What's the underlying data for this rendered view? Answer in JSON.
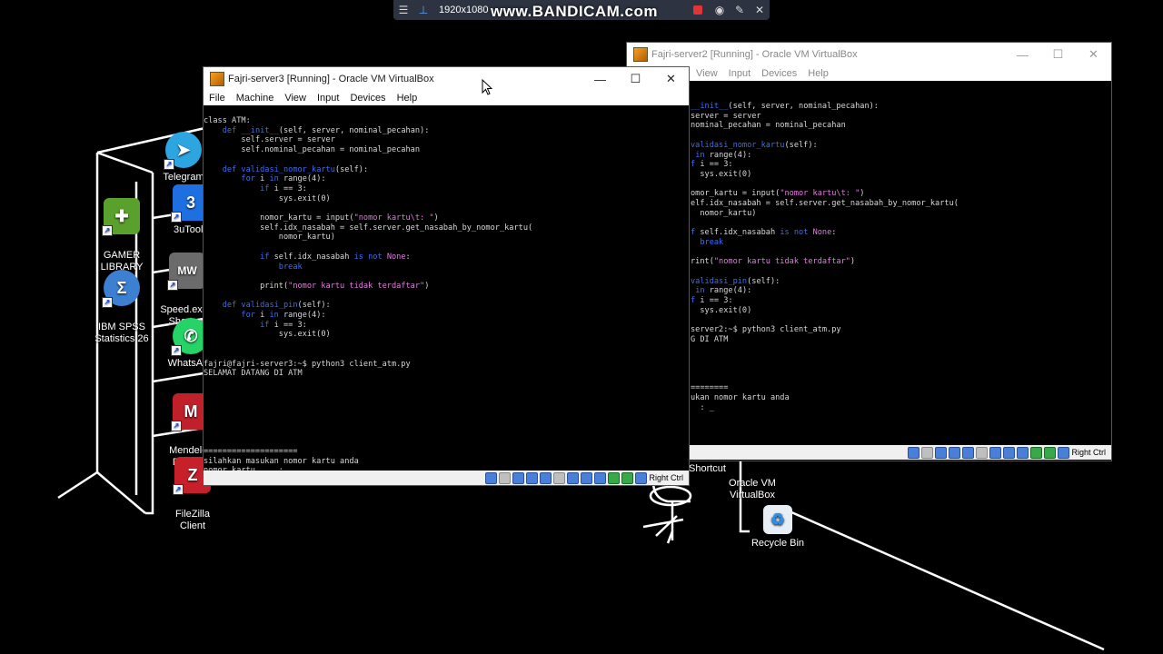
{
  "bandicam": {
    "resolution": "1920x1080",
    "watermark": "www.BANDICAM.com"
  },
  "desktop_icons": [
    {
      "label": "Telegram",
      "icon": "telegram-icon",
      "color": "#2ca5e0"
    },
    {
      "label": "GAMER\nLIBRARY",
      "icon": "gamepad-icon",
      "color": "#5aa02c"
    },
    {
      "label": "3uTools",
      "icon": "3utools-icon",
      "color": "#1e6fe0"
    },
    {
      "label": "Speed.exe -\nShortcut",
      "icon": "nfs-mw-icon",
      "color": "#6b6b6b"
    },
    {
      "label": "IBM SPSS\nStatistics 26",
      "icon": "spss-icon",
      "color": "#3d7fd1"
    },
    {
      "label": "WhatsApp",
      "icon": "whatsapp-icon",
      "color": "#25d366"
    },
    {
      "label": "Mendeley\nDesktop",
      "icon": "mendeley-icon",
      "color": "#c0202a"
    },
    {
      "label": "FileZilla\nClient",
      "icon": "filezilla-icon",
      "color": "#c8202a"
    },
    {
      "label": "Oracle VM\nVirtualBox",
      "icon": "virtualbox-icon",
      "color": "#1f5fae"
    },
    {
      "label": "Recycle Bin",
      "icon": "recycle-bin-icon",
      "color": "#2f8fe8"
    }
  ],
  "partial_label": "Shortcut",
  "win_front": {
    "title": "Fajri-server3 [Running] - Oracle VM VirtualBox",
    "menu": [
      "File",
      "Machine",
      "View",
      "Input",
      "Devices",
      "Help"
    ],
    "status_text": "Right Ctrl"
  },
  "win_back": {
    "title": "Fajri-server2 [Running] - Oracle VM VirtualBox",
    "menu": [
      "View",
      "Input",
      "Devices",
      "Help"
    ],
    "status_text": "Right Ctrl"
  }
}
